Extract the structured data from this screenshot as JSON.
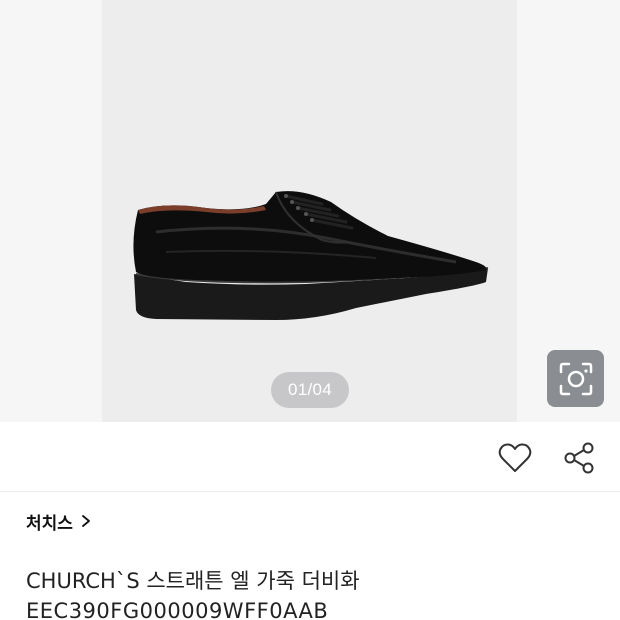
{
  "gallery": {
    "page_indicator": "01/04",
    "image_alt": "black leather derby shoe",
    "lens_icon": "camera-search-icon"
  },
  "actions": {
    "like_icon": "heart-icon",
    "share_icon": "share-icon"
  },
  "product": {
    "brand": "처치스",
    "brand_chevron_icon": "chevron-right-icon",
    "name": "CHURCH`S 스트래튼 엘 가죽 더비화",
    "code": "EEC390FG000009WFF0AAB"
  }
}
